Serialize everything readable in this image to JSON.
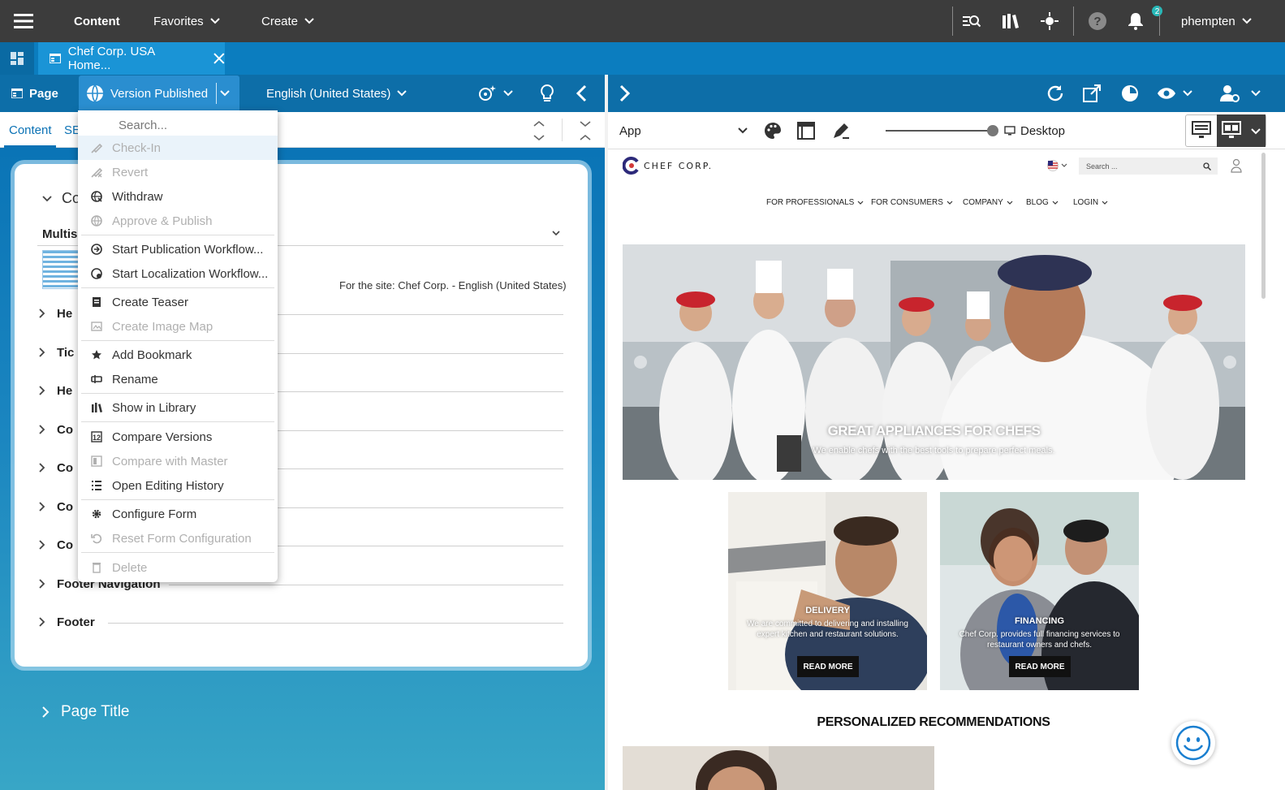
{
  "topbar": {
    "nav_items": [
      "Content",
      "Favorites",
      "Create"
    ],
    "notification_count": "2",
    "username": "phempten"
  },
  "tabs": {
    "active_tab_label": "Chef Corp. USA Home..."
  },
  "left_toolbar": {
    "page_label": "Page",
    "version_label": "Version Published",
    "locale_label": "English (United States)"
  },
  "left_subtabs": [
    "Content",
    "SE"
  ],
  "form": {
    "collapsed_header_partial": "Co",
    "multisite_label_partial": "Multisi",
    "site_info": "For the site: Chef Corp. - English (United States)",
    "sections_partial": [
      "He",
      "Tic",
      "He",
      "Co",
      "Co",
      "Co",
      "Co"
    ],
    "footer_navigation": "Footer Navigation",
    "footer": "Footer",
    "page_title": "Page Title"
  },
  "menu": {
    "search_placeholder": "Search...",
    "items": [
      {
        "label": "Check-In",
        "icon": "check-in-icon",
        "disabled": true
      },
      {
        "label": "Revert",
        "icon": "revert-icon",
        "disabled": true
      },
      {
        "label": "Withdraw",
        "icon": "withdraw-icon",
        "disabled": false
      },
      {
        "label": "Approve & Publish",
        "icon": "approve-publish-icon",
        "disabled": true
      },
      {
        "label": "Start Publication Workflow...",
        "icon": "workflow-icon",
        "disabled": false
      },
      {
        "label": "Start Localization Workflow...",
        "icon": "localization-workflow-icon",
        "disabled": false
      },
      {
        "label": "Create Teaser",
        "icon": "teaser-icon",
        "disabled": false
      },
      {
        "label": "Create Image Map",
        "icon": "image-map-icon",
        "disabled": true
      },
      {
        "label": "Add Bookmark",
        "icon": "star-icon",
        "disabled": false
      },
      {
        "label": "Rename",
        "icon": "rename-icon",
        "disabled": false
      },
      {
        "label": "Show in Library",
        "icon": "library-icon",
        "disabled": false
      },
      {
        "label": "Compare Versions",
        "icon": "compare-versions-icon",
        "disabled": false
      },
      {
        "label": "Compare with Master",
        "icon": "compare-master-icon",
        "disabled": true
      },
      {
        "label": "Open Editing History",
        "icon": "history-list-icon",
        "disabled": false
      },
      {
        "label": "Configure Form",
        "icon": "gear-icon",
        "disabled": false
      },
      {
        "label": "Reset Form Configuration",
        "icon": "reset-icon",
        "disabled": true
      },
      {
        "label": "Delete",
        "icon": "trash-icon",
        "disabled": true
      }
    ]
  },
  "preview_toolbar": {
    "app_label": "App",
    "device_label": "Desktop"
  },
  "site": {
    "logo_text": "CHEF CORP.",
    "search_placeholder": "Search ...",
    "nav": [
      "FOR PROFESSIONALS",
      "FOR CONSUMERS",
      "COMPANY",
      "BLOG",
      "LOGIN"
    ],
    "hero_title": "GREAT APPLIANCES FOR CHEFS",
    "hero_subtitle": "We enable chefs with the best tools to prepare perfect meals.",
    "teasers": [
      {
        "title": "DELIVERY",
        "text": "We are committed to delivering and installing expert kitchen and restaurant solutions.",
        "button": "READ MORE"
      },
      {
        "title": "FINANCING",
        "text": "Chef Corp. provides full financing services to restaurant owners and chefs.",
        "button": "READ MORE"
      }
    ],
    "recommendations_title": "PERSONALIZED RECOMMENDATIONS"
  },
  "colors": {
    "topbar": "#3c3c3c",
    "tabbar": "#0b7dbf",
    "toolbar": "#0d6ea8",
    "accent": "#1a94d6"
  }
}
